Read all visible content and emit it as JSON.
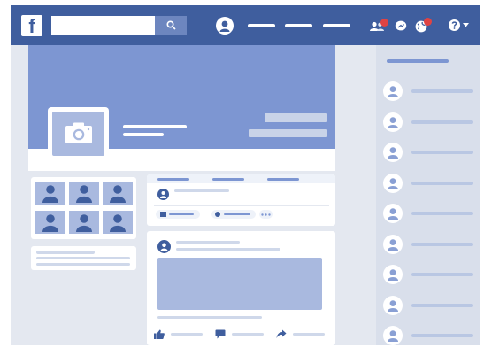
{
  "app": {
    "logo_text": "f"
  },
  "search": {
    "placeholder": "",
    "value": ""
  },
  "colors": {
    "brand": "#3f5e9e",
    "cover": "#7d96d2",
    "tile": "#a9b9df",
    "background": "#e4e8f0",
    "sidebar": "#d9dfeb",
    "notification_badge": "#e04343"
  },
  "icons": {
    "logo": "facebook-logo",
    "search": "search-icon",
    "user": "user-avatar-icon",
    "friend_requests": "friends-icon",
    "messages": "chat-icon",
    "notifications": "globe-icon",
    "help": "question-icon",
    "dropdown": "chevron-down-icon",
    "camera": "camera-icon",
    "like": "thumbs-up-icon",
    "comment": "comment-icon",
    "share": "share-arrow-icon",
    "photo": "photo-icon",
    "emoji": "emoji-icon",
    "more": "more-dots-icon"
  },
  "header": {
    "nav_placeholders": 3
  },
  "photos": {
    "rows": 2,
    "cols": 3
  },
  "composer": {
    "tabs": 3,
    "actions": [
      "photo",
      "feeling",
      "more"
    ]
  },
  "post": {
    "actions": [
      "like",
      "comment",
      "share"
    ]
  },
  "sidebar": {
    "contacts": 9
  }
}
